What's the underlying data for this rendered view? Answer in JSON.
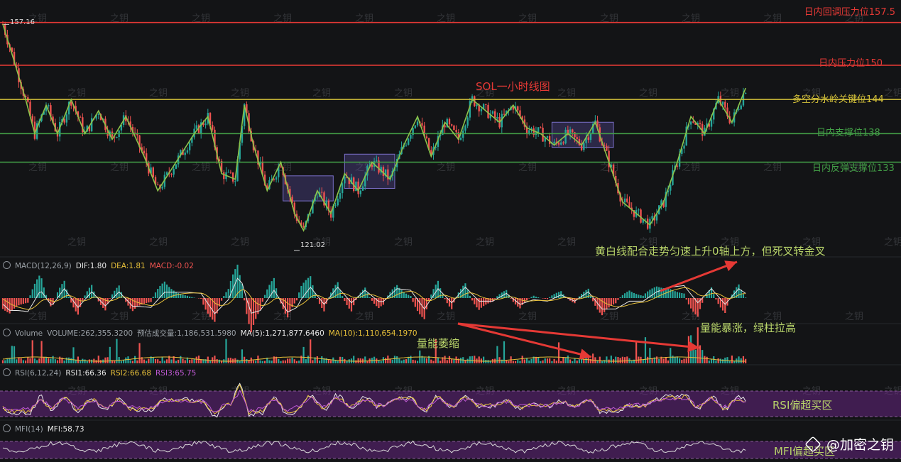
{
  "chart_data": {
    "type": "candlestick",
    "title": "SOL一小时线图",
    "price_extremes": {
      "high_label": "157.16",
      "low_label": "121.02",
      "high": 157.16,
      "low": 121.02
    },
    "ylim": [
      118.5,
      159.2
    ],
    "levels": [
      {
        "label": "日内回调压力位157.5",
        "value": 157.5,
        "color": "#e53935"
      },
      {
        "label": "日内压力位150",
        "value": 150,
        "color": "#e53935"
      },
      {
        "label": "多空分水岭关键位144",
        "value": 144,
        "color": "#d4c13a"
      },
      {
        "label": "日内支撑位138",
        "value": 138,
        "color": "#43a047"
      },
      {
        "label": "日内反弹支撑位133",
        "value": 133,
        "color": "#43a047"
      }
    ],
    "trend_path": [
      {
        "bar": 0,
        "price": 157.2
      },
      {
        "bar": 4,
        "price": 152
      },
      {
        "bar": 10,
        "price": 144
      },
      {
        "bar": 14,
        "price": 138
      },
      {
        "bar": 19,
        "price": 143
      },
      {
        "bar": 24,
        "price": 138
      },
      {
        "bar": 30,
        "price": 144
      },
      {
        "bar": 36,
        "price": 138
      },
      {
        "bar": 42,
        "price": 142
      },
      {
        "bar": 48,
        "price": 137
      },
      {
        "bar": 54,
        "price": 141
      },
      {
        "bar": 62,
        "price": 134
      },
      {
        "bar": 68,
        "price": 128
      },
      {
        "bar": 76,
        "price": 133
      },
      {
        "bar": 84,
        "price": 138
      },
      {
        "bar": 90,
        "price": 141
      },
      {
        "bar": 96,
        "price": 131
      },
      {
        "bar": 102,
        "price": 130
      },
      {
        "bar": 106,
        "price": 143
      },
      {
        "bar": 110,
        "price": 136
      },
      {
        "bar": 116,
        "price": 128
      },
      {
        "bar": 122,
        "price": 133
      },
      {
        "bar": 128,
        "price": 124
      },
      {
        "bar": 132,
        "price": 121
      },
      {
        "bar": 138,
        "price": 128
      },
      {
        "bar": 144,
        "price": 124
      },
      {
        "bar": 150,
        "price": 131
      },
      {
        "bar": 156,
        "price": 128
      },
      {
        "bar": 162,
        "price": 133
      },
      {
        "bar": 170,
        "price": 130
      },
      {
        "bar": 176,
        "price": 136
      },
      {
        "bar": 182,
        "price": 141
      },
      {
        "bar": 188,
        "price": 134
      },
      {
        "bar": 194,
        "price": 140
      },
      {
        "bar": 200,
        "price": 137
      },
      {
        "bar": 206,
        "price": 144
      },
      {
        "bar": 212,
        "price": 142
      },
      {
        "bar": 218,
        "price": 140
      },
      {
        "bar": 224,
        "price": 143
      },
      {
        "bar": 230,
        "price": 139
      },
      {
        "bar": 236,
        "price": 138
      },
      {
        "bar": 242,
        "price": 136
      },
      {
        "bar": 248,
        "price": 138
      },
      {
        "bar": 254,
        "price": 136
      },
      {
        "bar": 260,
        "price": 140
      },
      {
        "bar": 266,
        "price": 133
      },
      {
        "bar": 272,
        "price": 126
      },
      {
        "bar": 278,
        "price": 124
      },
      {
        "bar": 284,
        "price": 122
      },
      {
        "bar": 290,
        "price": 126
      },
      {
        "bar": 296,
        "price": 133
      },
      {
        "bar": 302,
        "price": 141
      },
      {
        "bar": 308,
        "price": 138
      },
      {
        "bar": 314,
        "price": 144
      },
      {
        "bar": 320,
        "price": 140
      },
      {
        "bar": 326,
        "price": 146
      }
    ],
    "consolidation_boxes": [
      {
        "bar_start": 123,
        "bar_end": 145,
        "price_low": 126.2,
        "price_high": 130.6
      },
      {
        "bar_start": 150,
        "bar_end": 172,
        "price_low": 128.4,
        "price_high": 134.4
      },
      {
        "bar_start": 241,
        "bar_end": 268,
        "price_low": 135.6,
        "price_high": 140.0
      }
    ],
    "annotations": [
      {
        "text": "黄白线配合走势匀速上升0轴上方，但死叉转金叉",
        "color": "#b8d46a"
      },
      {
        "text": "量能暴涨，绿柱拉高",
        "color": "#b8d46a"
      },
      {
        "text": "量能萎缩",
        "color": "#b8d46a"
      },
      {
        "text": "RSI偏超买区",
        "color": "#b8d46a"
      },
      {
        "text": "MFI偏超买区",
        "color": "#b8d46a"
      }
    ],
    "indicators": {
      "macd": {
        "label": "MACD(12,26,9)",
        "dif": "DIF:1.80",
        "dea": "DEA:1.81",
        "macd": "MACD:-0.02"
      },
      "volume": {
        "label": "Volume",
        "vol": "VOLUME:262,355.3200",
        "est": "预估成交量:1,186,531.5980",
        "ma5": "MA(5):1,271,877.6460",
        "ma10": "MA(10):1,110,654.1970"
      },
      "rsi": {
        "label": "RSI(6,12,24)",
        "rsi1": "RSI1:66.36",
        "rsi2": "RSI2:66.68",
        "rsi3": "RSI3:65.75"
      },
      "mfi": {
        "label": "MFI(14)",
        "mfi": "MFI:58.73"
      }
    }
  },
  "watermark": "之钥",
  "brand": {
    "name": "@加密之钥"
  },
  "colors": {
    "up": "#26a69a",
    "down": "#ef5350",
    "trend": "#8bc34a",
    "box_fill": "rgba(110,95,200,0.28)",
    "box_stroke": "#7a6fc8",
    "zone": "rgba(120,40,150,0.45)",
    "arrow": "#e53935"
  }
}
